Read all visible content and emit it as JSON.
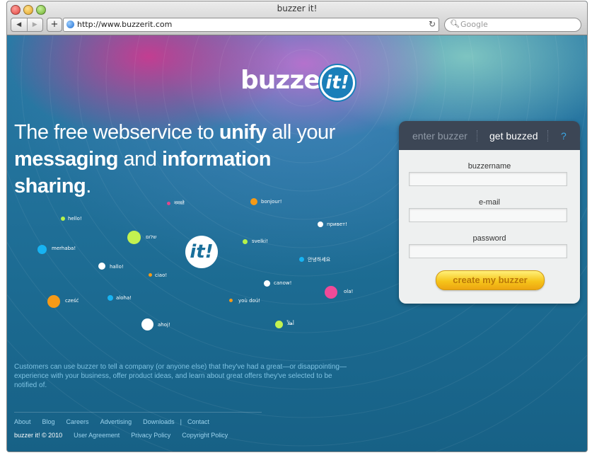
{
  "browser": {
    "window_title": "buzzer it!",
    "back_glyph": "◀",
    "forward_glyph": "▶",
    "add_glyph": "+",
    "url": "http://www.buzzerit.com",
    "reload_glyph": "↻",
    "search_placeholder": "Google",
    "search_glyph": "🔍︎"
  },
  "logo": {
    "word": "buzzer",
    "badge": "it!"
  },
  "headline": {
    "part1": "The free webservice to ",
    "bold1": "unify",
    "part2": " all your",
    "bold2": "messaging",
    "part3": " and ",
    "bold3": "information",
    "bold4": "sharing",
    "part4": "."
  },
  "center_badge": "it!",
  "greetings": [
    {
      "text": "नमस्ते",
      "color": "#e0488c"
    },
    {
      "text": "bonjour!",
      "color": "#f59a17"
    },
    {
      "text": "hello!",
      "color": "#b6f24a"
    },
    {
      "text": "привет!",
      "color": "#ffffff"
    },
    {
      "text": "שלום",
      "color": "#c3f250"
    },
    {
      "text": "svelki!",
      "color": "#b6f24a"
    },
    {
      "text": "merhaba!",
      "color": "#17b3f2"
    },
    {
      "text": "hallo!",
      "color": "#ffffff"
    },
    {
      "text": "ciao!",
      "color": "#f59a17"
    },
    {
      "text": "안녕하세요",
      "color": "#17b3f2"
    },
    {
      "text": "canow!",
      "color": "#ffffff"
    },
    {
      "text": "ola!",
      "color": "#f04a98"
    },
    {
      "text": "cześć",
      "color": "#f59a17"
    },
    {
      "text": "aloha!",
      "color": "#17b3f2"
    },
    {
      "text": "yoù doú!",
      "color": "#f59a17"
    },
    {
      "text": "ahoj!",
      "color": "#ffffff"
    },
    {
      "text": "أهلاً",
      "color": "#c3f250"
    }
  ],
  "blurb": "Customers can use buzzer to tell a company (or anyone else) that they've had a great—or disappointing—experience with your business, offer product ideas, and learn about great offers they've selected to be notified of.",
  "footer": {
    "links": [
      "About",
      "Blog",
      "Careers",
      "Advertising",
      "Downloads",
      "Contact"
    ],
    "divider": "|",
    "copyright": "buzzer it! © 2010",
    "legal": [
      "User Agreement",
      "Privacy Policy",
      "Copyright Policy"
    ]
  },
  "panel": {
    "tab_enter": "enter buzzer",
    "tab_get": "get buzzed",
    "tab_help": "?",
    "fields": [
      {
        "label": "buzzername",
        "value": ""
      },
      {
        "label": "e-mail",
        "value": ""
      },
      {
        "label": "password",
        "value": ""
      }
    ],
    "submit": "create my buzzer"
  }
}
